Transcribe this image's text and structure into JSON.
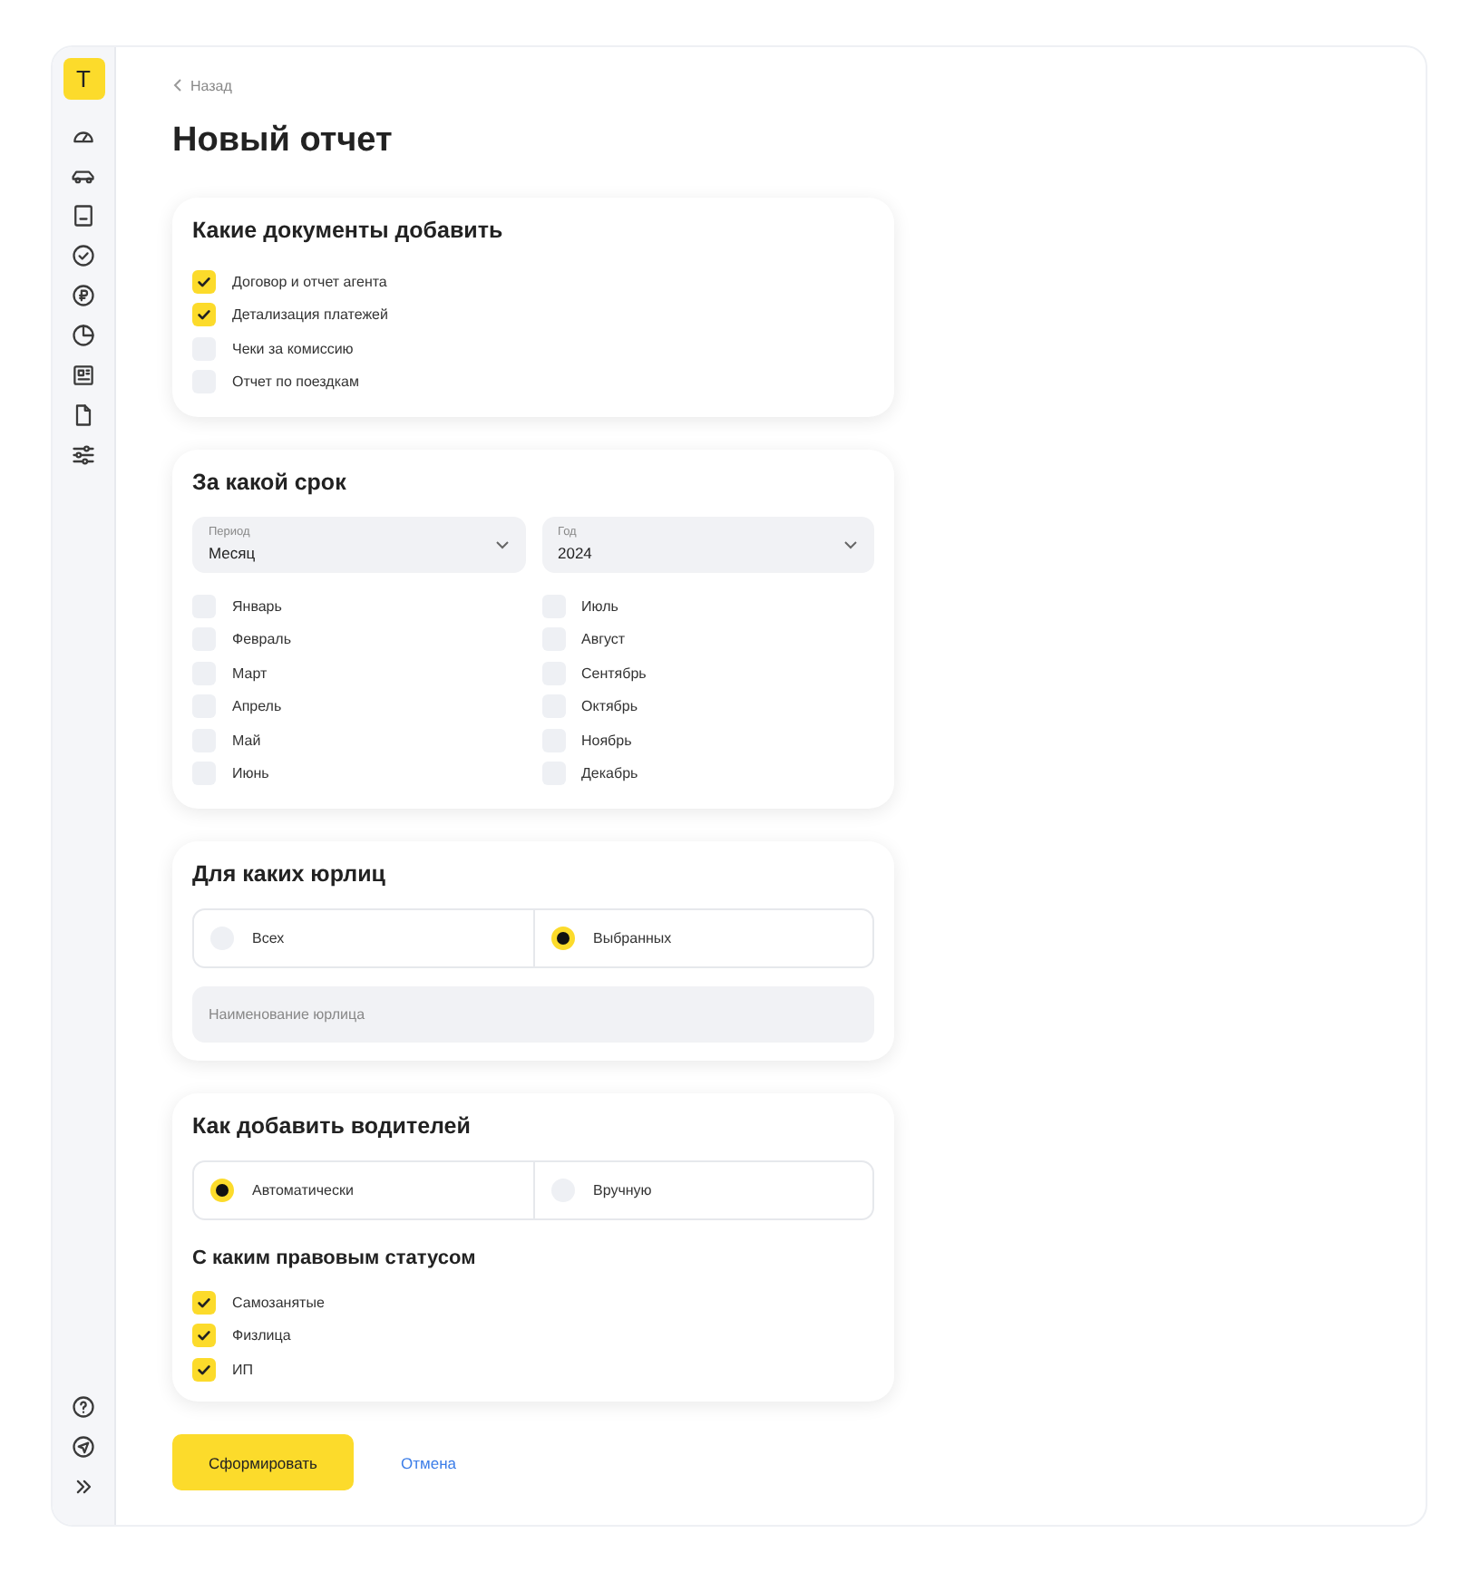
{
  "logo": "Т",
  "back_link": "Назад",
  "title": "Новый отчет",
  "documents": {
    "title": "Какие документы добавить",
    "options": [
      {
        "label": "Договор и отчет агента",
        "checked": true
      },
      {
        "label": "Детализация платежей",
        "checked": true
      },
      {
        "label": "Чеки за комиссию",
        "checked": false
      },
      {
        "label": "Отчет по поездкам",
        "checked": false
      }
    ]
  },
  "period": {
    "title": "За какой срок",
    "selects": [
      {
        "label": "Период",
        "value": "Месяц"
      },
      {
        "label": "Год",
        "value": "2024"
      }
    ],
    "months": [
      {
        "label": "Январь",
        "checked": false
      },
      {
        "label": "Февраль",
        "checked": false
      },
      {
        "label": "Март",
        "checked": false
      },
      {
        "label": "Апрель",
        "checked": false
      },
      {
        "label": "Май",
        "checked": false
      },
      {
        "label": "Июнь",
        "checked": false
      },
      {
        "label": "Июль",
        "checked": false
      },
      {
        "label": "Август",
        "checked": false
      },
      {
        "label": "Сентябрь",
        "checked": false
      },
      {
        "label": "Октябрь",
        "checked": false
      },
      {
        "label": "Ноябрь",
        "checked": false
      },
      {
        "label": "Декабрь",
        "checked": false
      }
    ]
  },
  "entities": {
    "title": "Для каких юрлиц",
    "options": [
      {
        "label": "Всех",
        "selected": false
      },
      {
        "label": "Выбранных",
        "selected": true
      }
    ],
    "search": {
      "placeholder": "Наименование юрлица"
    }
  },
  "drivers": {
    "title": "Как добавить водителей",
    "options": [
      {
        "label": "Автоматически",
        "selected": true
      },
      {
        "label": "Вручную",
        "selected": false
      }
    ],
    "subtitle": "С каким правовым статусом",
    "statuses": [
      {
        "label": "Самозанятые",
        "checked": true
      },
      {
        "label": "Физлица",
        "checked": true
      },
      {
        "label": "ИП",
        "checked": true
      }
    ]
  },
  "actions": {
    "submit": "Сформировать",
    "cancel": "Отмена"
  }
}
